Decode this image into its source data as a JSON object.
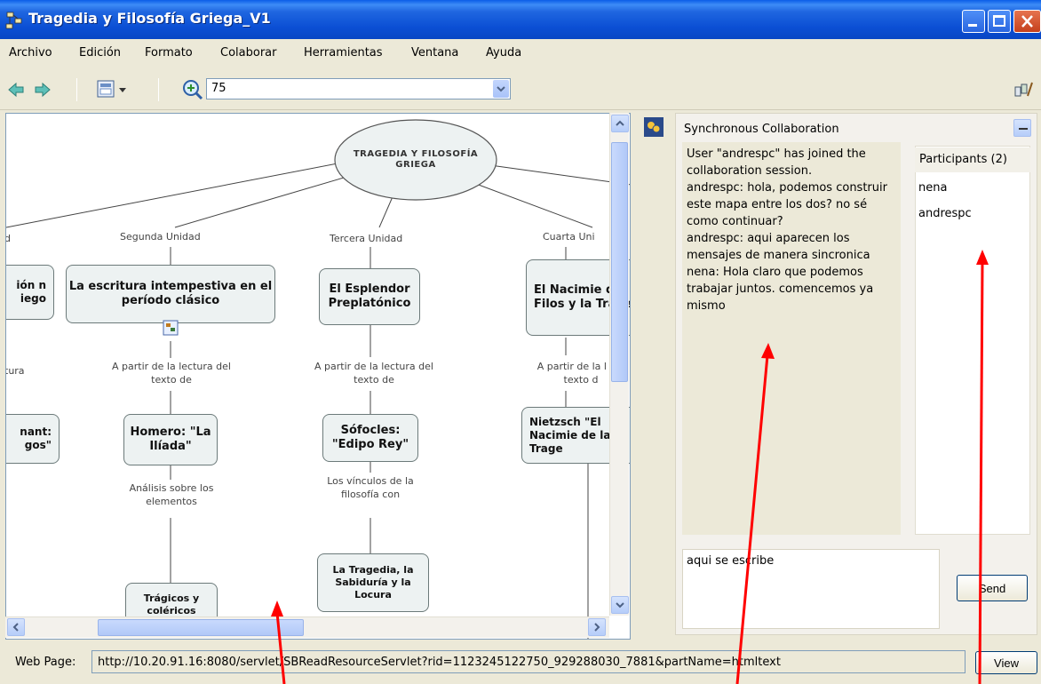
{
  "window": {
    "title": "Tragedia y Filosofía Griega_V1"
  },
  "menu": [
    "Archivo",
    "Edición",
    "Formato",
    "Colaborar",
    "Herramientas",
    "Ventana",
    "Ayuda"
  ],
  "toolbar": {
    "zoom_value": "75"
  },
  "map": {
    "root": "TRAGEDIA Y FILOSOFÍA GRIEGA",
    "unit_labels": [
      "d",
      "Segunda Unidad",
      "Tercera Unidad",
      "Cuarta Uni"
    ],
    "unit_nodes": [
      "ión n iego",
      "La escritura intempestiva en el período clásico",
      "El Esplendor Preplatónico",
      "El Nacimie de la Filos y la Trage"
    ],
    "link_reading": [
      "tura",
      "A partir de la lectura del texto de",
      "A partir de la lectura del texto de",
      "A partir de la l del texto d"
    ],
    "text_nodes": [
      "nant: gos\"",
      "Homero: \"La Ilíada\"",
      "Sófocles: \"Edipo Rey\"",
      "Nietzsch \"El Nacimie de la Trage"
    ],
    "link_analysis": [
      "Análisis sobre los elementos",
      "Los vínculos de la filosofía con"
    ],
    "bottom_nodes": [
      "Trágicos y coléricos",
      "La Tragedia, la Sabiduría y la Locura"
    ]
  },
  "collab": {
    "title": "Synchronous Collaboration",
    "messages": [
      "User \"andrespc\" has joined the collaboration session.",
      "andrespc: hola, podemos construir este mapa entre los dos? no sé como continuar?",
      "andrespc: aqui aparecen los mensajes de manera sincronica",
      "nena: Hola claro que podemos trabajar juntos. comencemos ya mismo"
    ],
    "participants_header": "Participants (2)",
    "participants": [
      "nena",
      "andrespc"
    ],
    "compose_text": "aqui se escribe",
    "send_label": "Send"
  },
  "status": {
    "url_label": "Web Page:",
    "url": "http://10.20.91.16:8080/servlet/SBReadResourceServlet?rid=1123245122750_929288030_7881&partName=htmltext",
    "view_label": "View"
  },
  "colors": {
    "title_bar": "#0b4fd4",
    "annotation_arrow": "#ff0000",
    "node_fill": "#edf2f2"
  }
}
